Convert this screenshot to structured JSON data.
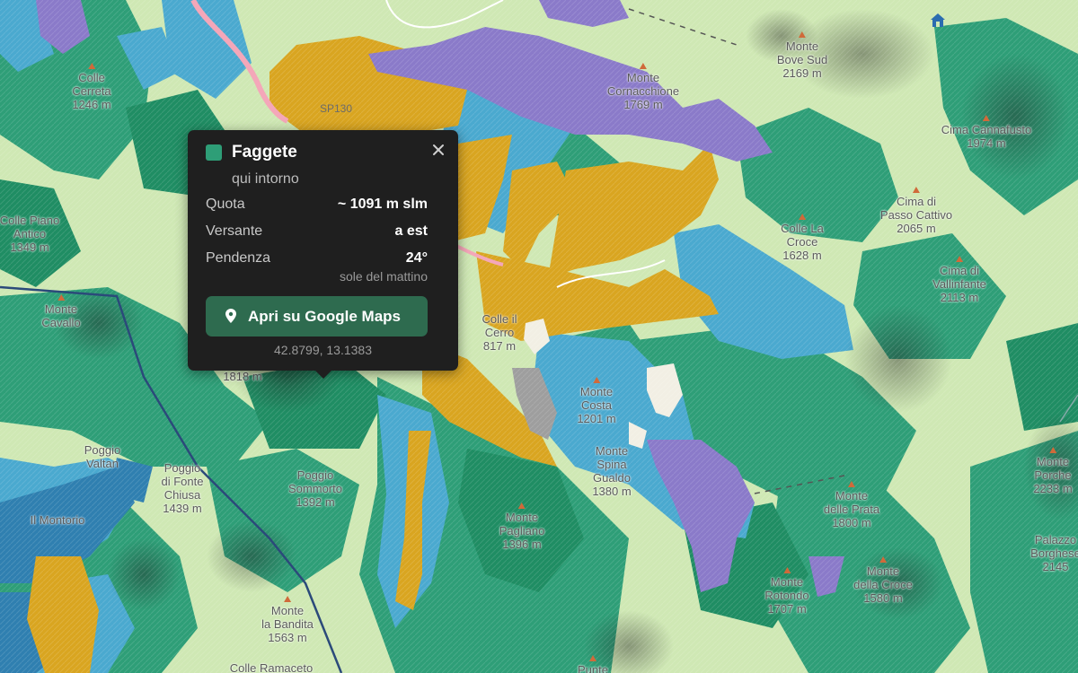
{
  "colors": {
    "meadow": "#cfe8b4",
    "beech_green": "#2e9e77",
    "dark_green": "#1f8d63",
    "blue": "#4aa9cf",
    "dark_blue": "#2f7fb0",
    "yellow": "#d9a520",
    "purple": "#8a7ac9",
    "accent": "#2e9e77",
    "button": "#2e6b4f",
    "popup_bg": "#1f1f1f"
  },
  "map_labels": {
    "colle_cerreta": {
      "name": "Colle\nCerreta",
      "elev": "1246 m"
    },
    "monte_cornacchione": {
      "name": "Monte\nCornacchione",
      "elev": "1769 m"
    },
    "monte_bove_sud": {
      "name": "Monte\nBove Sud",
      "elev": "2169 m"
    },
    "cima_cannafusto": {
      "name": "Cima Cannafusto",
      "elev": "1974 m"
    },
    "cima_passo_cattivo": {
      "name": "Cima di\nPasso Cattivo",
      "elev": "2065 m"
    },
    "colle_la_croce": {
      "name": "Colle La\nCroce",
      "elev": "1628 m"
    },
    "cima_vallinfante": {
      "name": "Cima di\nVallinfante",
      "elev": "2113 m"
    },
    "colle_piano_antico": {
      "name": "Colle Piano\nAntico",
      "elev": "1349 m"
    },
    "monte_cavallo": {
      "name": "Monte\nCavallo",
      "elev": ""
    },
    "colle_il_cerro": {
      "name": "Colle il\nCerro",
      "elev": "817 m"
    },
    "monte_costa": {
      "name": "Monte\nCosta",
      "elev": "1201 m"
    },
    "monte_spina_gualdo": {
      "name": "Monte\nSpina\nGualdo",
      "elev": "1380 m"
    },
    "poggio_valtan": {
      "name": "Poggio\nValtan",
      "elev": ""
    },
    "poggio_fonte_chiusa": {
      "name": "Poggio\ndi Fonte\nChiusa",
      "elev": "1439 m"
    },
    "poggio_sommorto": {
      "name": "Poggio\nSommorto",
      "elev": "1392 m"
    },
    "monte_pagliano": {
      "name": "Monte\nPagliano",
      "elev": "1396 m"
    },
    "monte_delle_prata": {
      "name": "Monte\ndelle Prata",
      "elev": "1800 m"
    },
    "monte_porche": {
      "name": "Monte\nPorche",
      "elev": "2233 m"
    },
    "monte_rotondo": {
      "name": "Monte\nRotondo",
      "elev": "1707 m"
    },
    "monte_della_croce": {
      "name": "Monte\ndella Croce",
      "elev": "1580 m"
    },
    "palazzo_borghese": {
      "name": "Palazzo\nBorghese",
      "elev": "2145"
    },
    "monte_la_bandita": {
      "name": "Monte\nla Bandita",
      "elev": "1563 m"
    },
    "colle_ramaceto": {
      "name": "Colle Ramaceto",
      "elev": ""
    },
    "il_montorio": {
      "name": "Il Montorio",
      "elev": ""
    },
    "elev_1818": {
      "name": "",
      "elev": "1818 m"
    },
    "punte": {
      "name": "Punte",
      "elev": ""
    }
  },
  "road_label": "SP130",
  "popup": {
    "title": "Faggete",
    "subtitle": "qui intorno",
    "close_icon": "close-icon",
    "rows": [
      {
        "key": "Quota",
        "value": "~ 1091 m slm"
      },
      {
        "key": "Versante",
        "value": "a est"
      },
      {
        "key": "Pendenza",
        "value": "24°"
      }
    ],
    "slope_note": "sole del mattino",
    "button_label": "Apri su Google Maps",
    "button_icon": "map-pin-icon",
    "coordinates": "42.8799, 13.1383"
  }
}
